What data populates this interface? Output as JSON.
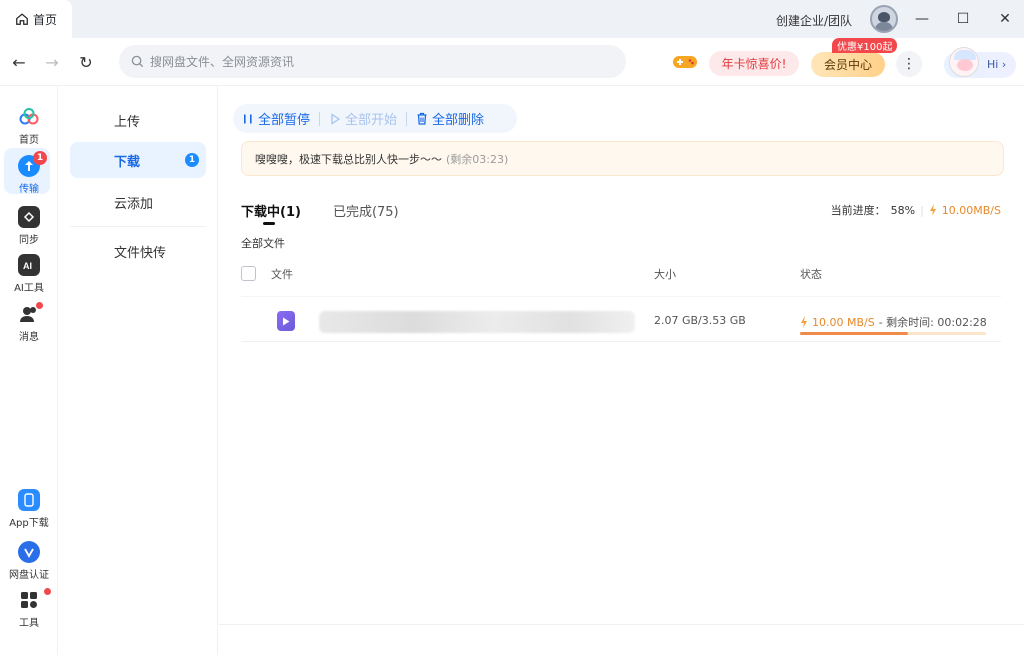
{
  "titlebar": {
    "home_tab": "首页",
    "create_team": "创建企业/团队",
    "win_min": "—",
    "win_max": "☐",
    "win_close": "✕"
  },
  "toolbar": {
    "back": "←",
    "forward": "→",
    "refresh": "↻",
    "search_placeholder": "搜网盘文件、全网资源资讯",
    "promo": "年卡惊喜价!",
    "vip": "会员中心",
    "discount": "优惠¥100起",
    "more": "⋮",
    "hi": "Hi ›"
  },
  "rail": {
    "items": [
      {
        "label": "首页",
        "icon": "cloud-logo-icon"
      },
      {
        "label": "传输",
        "icon": "transfer-icon",
        "badge": "1"
      },
      {
        "label": "同步",
        "icon": "sync-icon"
      },
      {
        "label": "AI工具",
        "icon": "ai-tools-icon"
      },
      {
        "label": "消息",
        "icon": "message-icon"
      },
      {
        "label": "App下载",
        "icon": "phone-icon"
      },
      {
        "label": "网盘认证",
        "icon": "verify-icon"
      },
      {
        "label": "工具",
        "icon": "tools-grid-icon"
      }
    ]
  },
  "subnav": {
    "upload": "上传",
    "download": "下载",
    "download_count": "1",
    "cloud_add": "云添加",
    "quick_transfer": "文件快传"
  },
  "main": {
    "actions": {
      "pause_all": "全部暂停",
      "start_all": "全部开始",
      "delete_all": "全部删除"
    },
    "notice": {
      "text": "嗖嗖嗖，极速下载总比别人快一步～～",
      "remain": "(剩余03:23)"
    },
    "tabs": {
      "downloading": "下载中(1)",
      "completed": "已完成(75)"
    },
    "progress": {
      "label": "当前进度：",
      "percent": "58%",
      "speed": "10.00MB/S"
    },
    "section_title": "全部文件",
    "table": {
      "col_file": "文件",
      "col_size": "大小",
      "col_status": "状态"
    },
    "rows": [
      {
        "size": "2.07 GB/3.53 GB",
        "speed": "10.00 MB/S",
        "remain_label": "- 剩余时间: 00:02:28",
        "progress": 0.58
      }
    ]
  },
  "colors": {
    "accent": "#1a6ae6",
    "orange": "#e8892a",
    "red": "#f2484b"
  }
}
